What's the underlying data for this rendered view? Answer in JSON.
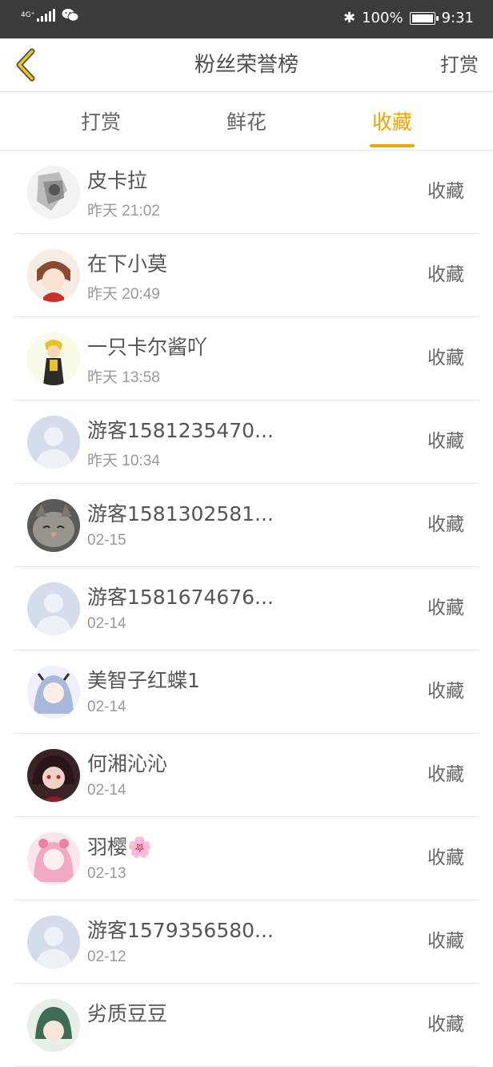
{
  "status_bar": {
    "network": "4G⁺",
    "battery_percent": "100%",
    "time": "9:31"
  },
  "header": {
    "title": "粉丝荣誉榜",
    "right_action": "打赏"
  },
  "tabs": [
    {
      "label": "打赏",
      "active": false
    },
    {
      "label": "鲜花",
      "active": false
    },
    {
      "label": "收藏",
      "active": true
    }
  ],
  "fans": [
    {
      "name": "皮卡拉",
      "time": "昨天 21:02",
      "action": "收藏",
      "avatar": "sketch"
    },
    {
      "name": "在下小莫",
      "time": "昨天 20:49",
      "action": "收藏",
      "avatar": "anime-red"
    },
    {
      "name": "一只卡尔酱吖",
      "time": "昨天 13:58",
      "action": "收藏",
      "avatar": "anime-yellow"
    },
    {
      "name": "游客1581235470...",
      "time": "昨天 10:34",
      "action": "收藏",
      "avatar": "default"
    },
    {
      "name": "游客1581302581...",
      "time": "02-15",
      "action": "收藏",
      "avatar": "cat"
    },
    {
      "name": "游客1581674676...",
      "time": "02-14",
      "action": "收藏",
      "avatar": "default"
    },
    {
      "name": "美智子红蝶1",
      "time": "02-14",
      "action": "收藏",
      "avatar": "anime-blue"
    },
    {
      "name": "何湘沁沁",
      "time": "02-14",
      "action": "收藏",
      "avatar": "anime-dark"
    },
    {
      "name": "羽樱🌸",
      "time": "02-13",
      "action": "收藏",
      "avatar": "anime-pink"
    },
    {
      "name": "游客1579356580...",
      "time": "02-12",
      "action": "收藏",
      "avatar": "default"
    },
    {
      "name": "劣质豆豆",
      "time": "",
      "action": "收藏",
      "avatar": "anime-green"
    }
  ],
  "colors": {
    "accent": "#f0a500",
    "status_bar": "#3b3b3b",
    "divider": "#e6e6e6"
  }
}
